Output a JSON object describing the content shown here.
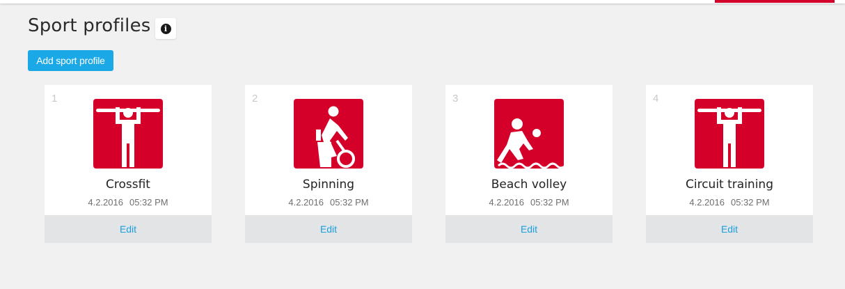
{
  "header": {
    "title": "Sport profiles",
    "info_icon": "info-circle-icon",
    "info_glyph": "i",
    "accent_color": "#d3002b"
  },
  "actions": {
    "add_label": "Add sport profile",
    "add_color": "#1ba8e6"
  },
  "profiles": [
    {
      "number": "1",
      "name": "Crossfit",
      "date": "4.2.2016",
      "time": "05:32 PM",
      "icon": "pull-up-icon",
      "edit_label": "Edit"
    },
    {
      "number": "2",
      "name": "Spinning",
      "date": "4.2.2016",
      "time": "05:32 PM",
      "icon": "indoor-cycling-icon",
      "edit_label": "Edit"
    },
    {
      "number": "3",
      "name": "Beach volley",
      "date": "4.2.2016",
      "time": "05:32 PM",
      "icon": "volleyball-icon",
      "edit_label": "Edit"
    },
    {
      "number": "4",
      "name": "Circuit training",
      "date": "4.2.2016",
      "time": "05:32 PM",
      "icon": "pull-up-icon",
      "edit_label": "Edit"
    }
  ],
  "colors": {
    "icon_background": "#d5002a",
    "card_footer": "#e3e4e6",
    "link": "#1a9fe0"
  }
}
